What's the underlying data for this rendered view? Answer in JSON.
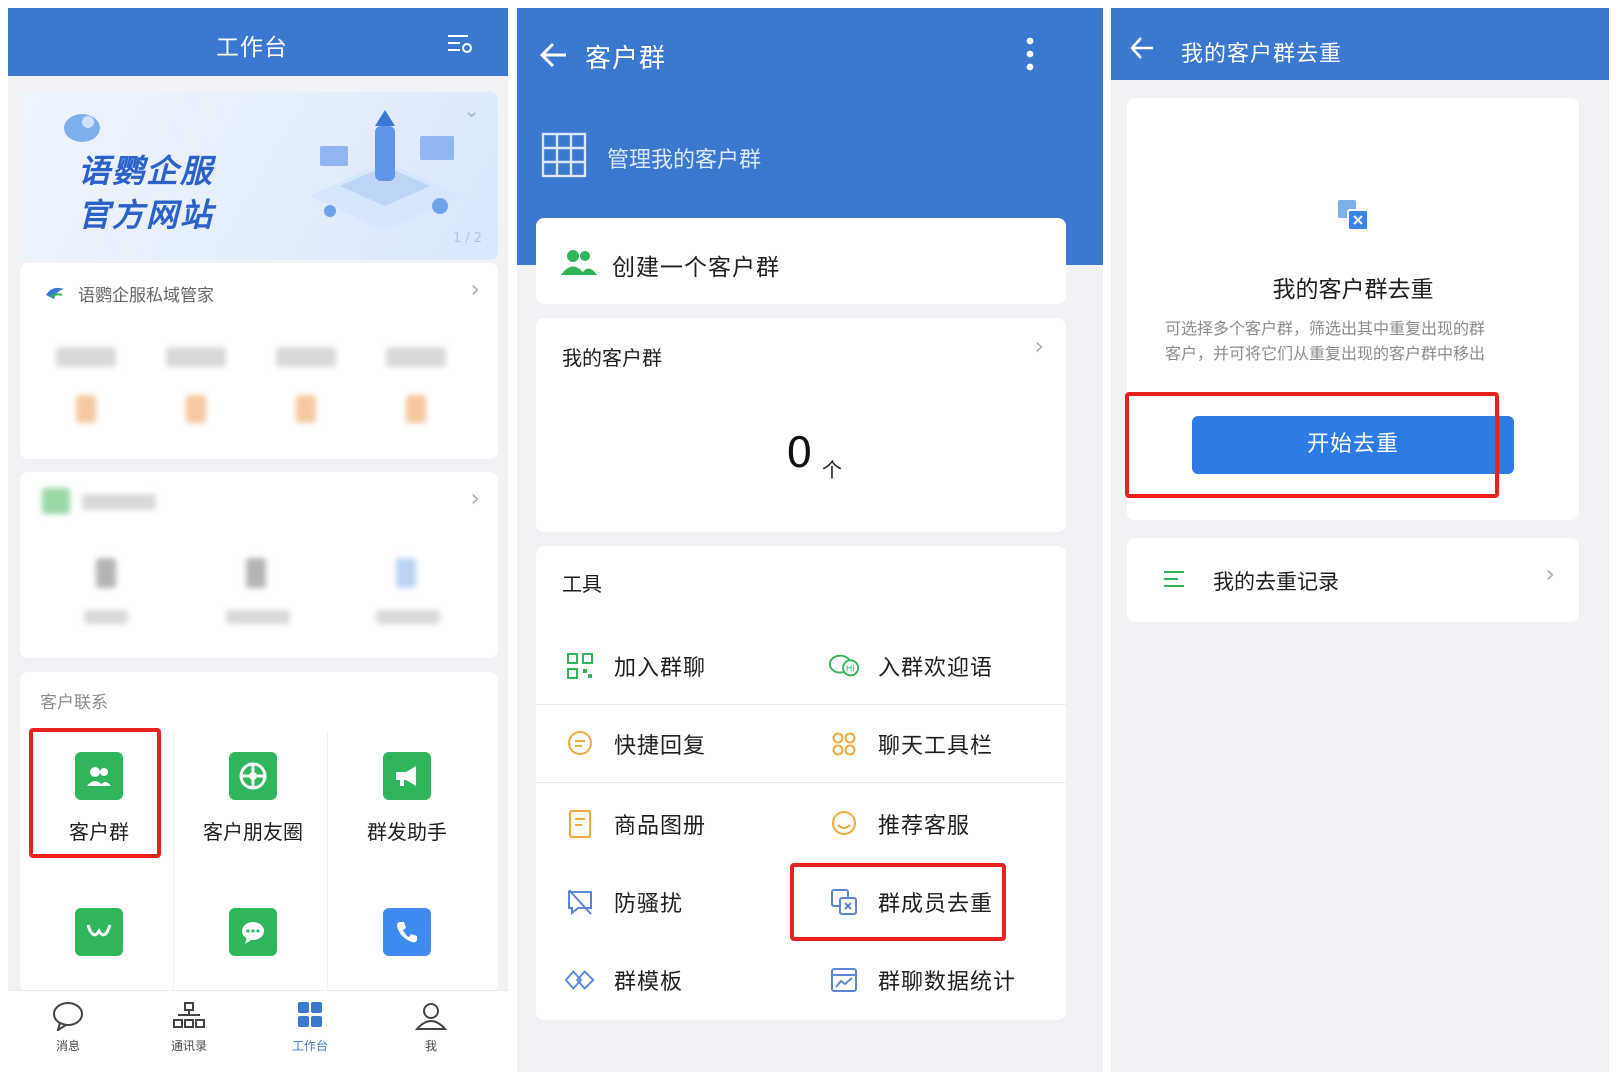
{
  "workbench": {
    "header": {
      "title": "工作台"
    },
    "banner": {
      "line1": "语鹦企服",
      "line2": "官方网站",
      "pager": "1 / 2"
    },
    "private_domain": {
      "title": "语鹦企服私域管家"
    },
    "customer_contact": {
      "section_title": "客户联系",
      "tiles": [
        {
          "label": "客户群",
          "icon": "customer-group-icon"
        },
        {
          "label": "客户朋友圈",
          "icon": "moments-icon"
        },
        {
          "label": "群发助手",
          "icon": "broadcast-icon"
        }
      ]
    },
    "tabbar": [
      {
        "label": "消息",
        "icon": "message-icon"
      },
      {
        "label": "通讯录",
        "icon": "contacts-icon"
      },
      {
        "label": "工作台",
        "icon": "workbench-icon",
        "active": true
      },
      {
        "label": "我",
        "icon": "profile-icon"
      }
    ],
    "colors": {
      "header": "#3b78d0",
      "tile_green": "#2fb55a",
      "highlight": "#e8231e"
    }
  },
  "customer_group": {
    "header": {
      "title": "客户群"
    },
    "manage": {
      "label": "管理我的客户群"
    },
    "create": {
      "label": "创建一个客户群"
    },
    "my_groups": {
      "title": "我的客户群",
      "count": "0",
      "unit": "个"
    },
    "tools": {
      "title": "工具",
      "items": [
        {
          "label": "加入群聊",
          "icon": "qr-code-icon"
        },
        {
          "label": "入群欢迎语",
          "icon": "welcome-chat-icon"
        },
        {
          "label": "快捷回复",
          "icon": "quick-reply-icon"
        },
        {
          "label": "聊天工具栏",
          "icon": "toolbar-icon"
        },
        {
          "label": "商品图册",
          "icon": "catalog-icon"
        },
        {
          "label": "推荐客服",
          "icon": "recommend-service-icon"
        },
        {
          "label": "防骚扰",
          "icon": "anti-harassment-icon"
        },
        {
          "label": "群成员去重",
          "icon": "dedupe-icon"
        },
        {
          "label": "群模板",
          "icon": "template-icon"
        },
        {
          "label": "群聊数据统计",
          "icon": "stats-icon"
        }
      ]
    }
  },
  "dedupe": {
    "header": {
      "title": "我的客户群去重"
    },
    "card": {
      "title": "我的客户群去重",
      "description_line1": "可选择多个客户群，筛选出其中重复出现的群",
      "description_line2": "客户，并可将它们从重复出现的客户群中移出",
      "button": "开始去重"
    },
    "records": {
      "label": "我的去重记录"
    },
    "colors": {
      "button": "#2e7be6"
    }
  }
}
